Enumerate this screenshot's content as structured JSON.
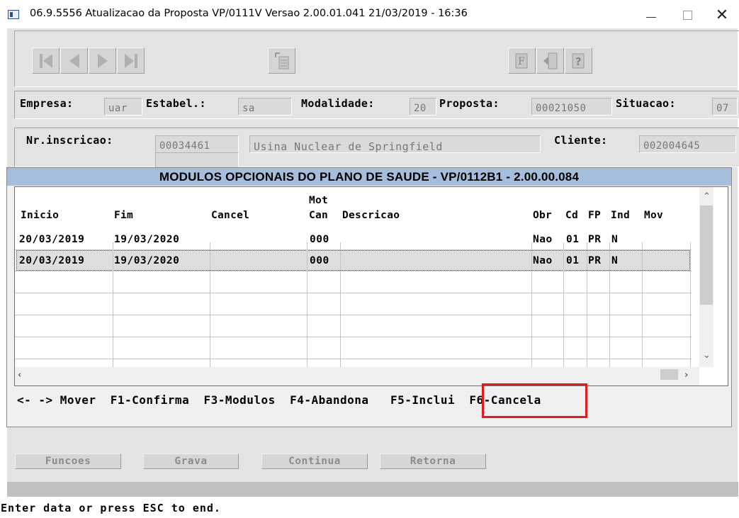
{
  "window": {
    "title": "06.9.5556 Atualizacao da Proposta VP/0111V Versao 2.00.01.041 21/03/2019 - 16:36",
    "close_glyph": "✕"
  },
  "toolbar": {
    "icons": [
      "first-icon",
      "previous-icon",
      "next-icon",
      "last-icon",
      "go-to-icon",
      "function-icon",
      "exit-icon",
      "help-icon"
    ]
  },
  "header": {
    "empresa_label": "Empresa:",
    "empresa_value": "uar",
    "estabel_label": "Estabel.:",
    "estabel_value": "sa",
    "modalidade_label": "Modalidade:",
    "modalidade_value": "20",
    "proposta_label": "Proposta:",
    "proposta_value": "00021050",
    "situacao_label": "Situacao:",
    "situacao_value": "07"
  },
  "client_info": {
    "inscricao_label": "Nr.inscricao:",
    "inscricao_value": "00034461",
    "nome_value": "Usina Nuclear de Springfield",
    "cliente_label": "Cliente:",
    "cliente_value": "002004645"
  },
  "dialog": {
    "title": "MODULOS OPCIONAIS DO PLANO DE SAUDE - VP/0112B1 - 2.00.00.084",
    "columns": {
      "inicio": "Inicio",
      "fim": "Fim",
      "cancel": "Cancel",
      "mot_top": "Mot",
      "mot_bottom": "Can",
      "descricao": "Descricao",
      "obr": "Obr",
      "cd": "Cd",
      "fp": "FP",
      "ind": "Ind",
      "mov": "Mov"
    },
    "rows": [
      {
        "inicio": "20/03/2019",
        "fim": "19/03/2020",
        "cancel": "",
        "mot": "000",
        "descricao": "",
        "obr": "Nao",
        "cd": "01",
        "fp": "PR",
        "ind": "N",
        "mov": ""
      },
      {
        "inicio": "20/03/2019",
        "fim": "19/03/2020",
        "cancel": "",
        "mot": "000",
        "descricao": "",
        "obr": "Nao",
        "cd": "01",
        "fp": "PR",
        "ind": "N",
        "mov": ""
      }
    ],
    "shortcuts": {
      "mover": "<- -> Mover",
      "confirma": "F1-Confirma",
      "modulos": "F3-Modulos",
      "abandona": "F4-Abandona",
      "inclui": "F5-Inclui",
      "cancela": "F6-Cancela"
    }
  },
  "buttons": {
    "funcoes": "Funcoes",
    "grava": "Grava",
    "continua": "Continua",
    "retorna": "Retorna"
  },
  "status_bar": {
    "text": "Enter data or press ESC to end."
  },
  "colors": {
    "dialog_title_bg": "#a6bedc",
    "highlight": "#e31b1b"
  }
}
